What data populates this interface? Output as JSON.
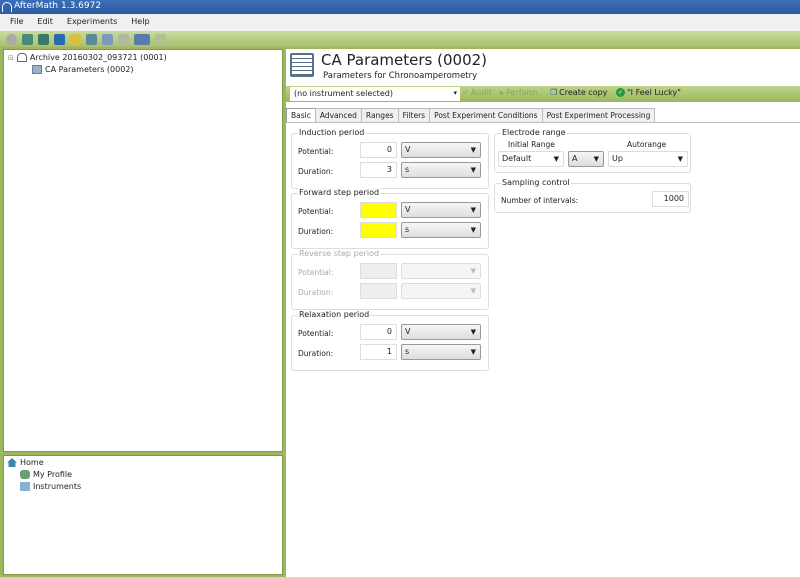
{
  "window": {
    "title": "AfterMath 1.3.6972"
  },
  "menu": [
    "File",
    "Edit",
    "Experiments",
    "Help"
  ],
  "tree": {
    "archive": "Archive  20160302_093721 (0001)",
    "child": "CA Parameters (0002)"
  },
  "nav": {
    "home": "Home",
    "profile": "My Profile",
    "instruments": "Instruments"
  },
  "header": {
    "title": "CA Parameters (0002)",
    "subtitle": "Parameters for Chronoamperometry"
  },
  "actions": {
    "instrument": "(no instrument selected)",
    "audit": "Audit",
    "perform": "Perform",
    "create_copy": "Create copy",
    "lucky": "\"I Feel Lucky\""
  },
  "tabs": [
    "Basic",
    "Advanced",
    "Ranges",
    "Filters",
    "Post Experiment Conditions",
    "Post Experiment Processing"
  ],
  "induction": {
    "title": "Induction period",
    "potential_label": "Potential:",
    "potential": "0",
    "potential_unit": "V",
    "duration_label": "Duration:",
    "duration": "3",
    "duration_unit": "s"
  },
  "forward": {
    "title": "Forward step period",
    "potential_label": "Potential:",
    "potential": "",
    "potential_unit": "V",
    "duration_label": "Duration:",
    "duration": "",
    "duration_unit": "s"
  },
  "reverse": {
    "title": "Reverse step period",
    "potential_label": "Potential:",
    "duration_label": "Duration:"
  },
  "relaxation": {
    "title": "Relaxation period",
    "potential_label": "Potential:",
    "potential": "0",
    "potential_unit": "V",
    "duration_label": "Duration:",
    "duration": "1",
    "duration_unit": "s"
  },
  "electrode": {
    "title": "Electrode range",
    "initial_label": "Initial Range",
    "initial": "Default",
    "unit": "A",
    "autorange_label": "Autorange",
    "autorange": "Up"
  },
  "sampling": {
    "title": "Sampling control",
    "intervals_label": "Number of intervals:",
    "intervals": "1000"
  }
}
